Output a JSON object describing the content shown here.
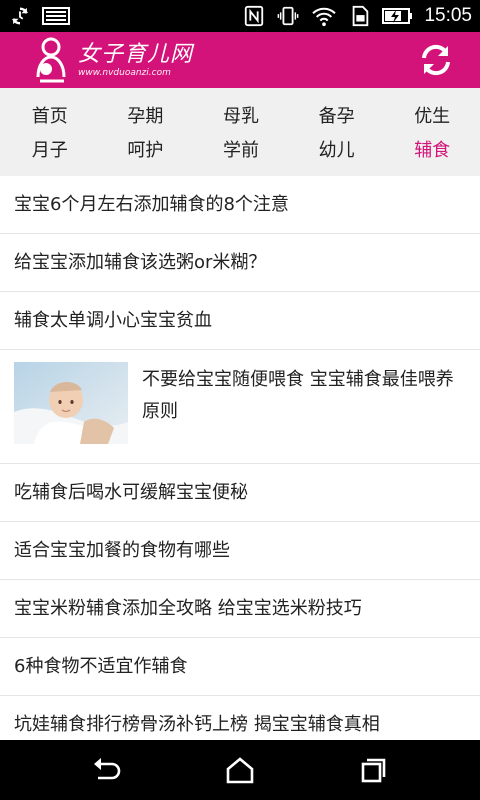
{
  "status_bar": {
    "time": "15:05",
    "icons": [
      "sync-icon",
      "keyboard-icon",
      "nfc-icon",
      "vibrate-icon",
      "wifi-icon",
      "sim-icon",
      "battery-charging-icon"
    ]
  },
  "header": {
    "app_title": "女子育儿网",
    "app_url": "www.nvduoanzi.com",
    "refresh_icon": "refresh-icon",
    "color": "#d4137a"
  },
  "categories": [
    {
      "label": "首页"
    },
    {
      "label": "孕期"
    },
    {
      "label": "母乳"
    },
    {
      "label": "备孕"
    },
    {
      "label": "优生"
    },
    {
      "label": "月子"
    },
    {
      "label": "呵护"
    },
    {
      "label": "学前"
    },
    {
      "label": "幼儿"
    },
    {
      "label": "辅食",
      "active": true
    }
  ],
  "articles": [
    {
      "title": "宝宝6个月左右添加辅食的8个注意"
    },
    {
      "title": "给宝宝添加辅食该选粥or米糊？"
    },
    {
      "title": "辅食太单调小心宝宝贫血"
    },
    {
      "title": "不要给宝宝随便喂食 宝宝辅食最佳喂养原则",
      "image": "baby-photo"
    },
    {
      "title": "吃辅食后喝水可缓解宝宝便秘"
    },
    {
      "title": "适合宝宝加餐的食物有哪些"
    },
    {
      "title": "宝宝米粉辅食添加全攻略 给宝宝选米粉技巧"
    },
    {
      "title": "6种食物不适宜作辅食"
    },
    {
      "title": "坑娃辅食排行榜骨汤补钙上榜 揭宝宝辅食真相"
    }
  ],
  "nav_bar": {
    "icons": [
      "back-icon",
      "home-icon",
      "recents-icon"
    ]
  }
}
